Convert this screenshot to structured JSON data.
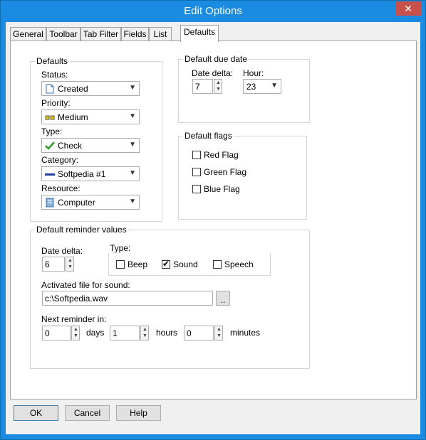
{
  "window": {
    "title": "Edit Options",
    "close": "✕"
  },
  "tabs": [
    "General",
    "Toolbar",
    "Tab Filter",
    "Fields",
    "List",
    "Defaults"
  ],
  "defaults_group": {
    "title": "Defaults",
    "status_label": "Status:",
    "status_value": "Created",
    "priority_label": "Priority:",
    "priority_value": "Medium",
    "type_label": "Type:",
    "type_value": "Check",
    "category_label": "Category:",
    "category_value": "Softpedia #1",
    "resource_label": "Resource:",
    "resource_value": "Computer"
  },
  "due_group": {
    "title": "Default due date",
    "delta_label": "Date delta:",
    "delta_value": "7",
    "hour_label": "Hour:",
    "hour_value": "23"
  },
  "flags_group": {
    "title": "Default flags",
    "red": "Red Flag",
    "green": "Green Flag",
    "blue": "Blue Flag"
  },
  "reminder_group": {
    "title": "Default reminder values",
    "delta_label": "Date delta:",
    "delta_value": "6",
    "type_label": "Type:",
    "beep": "Beep",
    "sound": "Sound",
    "speech": "Speech",
    "file_label": "Activated file for sound:",
    "file_value": "c:\\Softpedia.wav",
    "browse": "..",
    "next_label": "Next reminder in:",
    "days_value": "0",
    "days_label": "days",
    "hours_value": "1",
    "hours_label": "hours",
    "minutes_value": "0",
    "minutes_label": "minutes"
  },
  "buttons": {
    "ok": "OK",
    "cancel": "Cancel",
    "help": "Help"
  },
  "colors": {
    "titlebar": "#1a8be0",
    "close": "#c7504a"
  }
}
